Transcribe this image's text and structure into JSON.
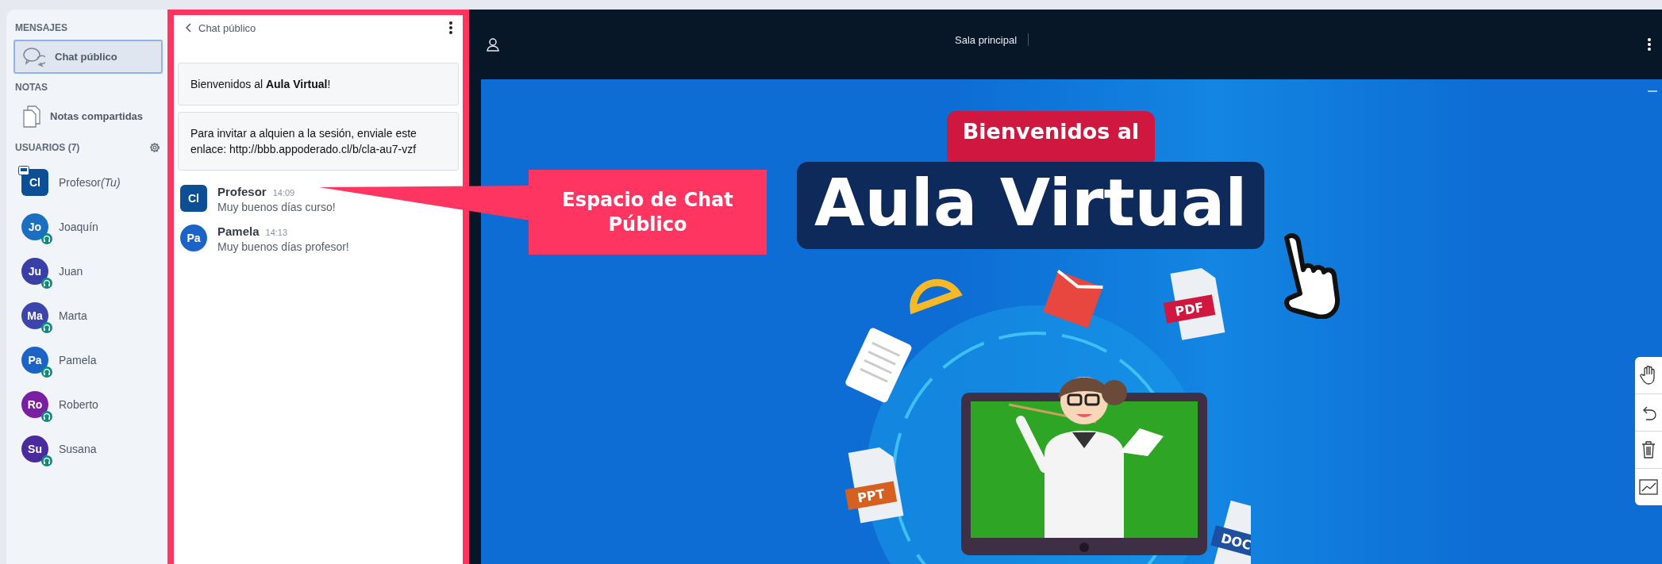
{
  "sidebar": {
    "sections": [
      {
        "heading": "MENSAJES",
        "items": [
          {
            "label": "Chat público",
            "kind": "chat",
            "selected": true
          }
        ]
      },
      {
        "heading": "NOTAS",
        "items": [
          {
            "label": "Notas compartidas",
            "kind": "notes",
            "selected": false
          }
        ]
      }
    ],
    "users_heading": "USUARIOS (7)",
    "users": [
      {
        "initials": "Cl",
        "name": "Profesor",
        "suffix": "(Tu)",
        "kind": "moderator",
        "color": "#0d4f94"
      },
      {
        "initials": "Jo",
        "name": "Joaquín",
        "kind": "viewer",
        "color": "#1b6fc0"
      },
      {
        "initials": "Ju",
        "name": "Juan",
        "kind": "viewer",
        "color": "#3a3fa8"
      },
      {
        "initials": "Ma",
        "name": "Marta",
        "kind": "viewer",
        "color": "#3b45ab"
      },
      {
        "initials": "Pa",
        "name": "Pamela",
        "kind": "viewer",
        "color": "#1c63c7"
      },
      {
        "initials": "Ro",
        "name": "Roberto",
        "kind": "viewer",
        "color": "#7b1fa2"
      },
      {
        "initials": "Su",
        "name": "Susana",
        "kind": "viewer",
        "color": "#4a2a9f"
      }
    ]
  },
  "chat": {
    "title": "Chat público",
    "notices": [
      "Bienvenidos al **Aula Virtual**!",
      "Para invitar a alquien a la sesión, enviale este enlace: http://bbb.appoderado.cl/b/cla-au7-vzf"
    ],
    "messages": [
      {
        "initials": "Cl",
        "sender": "Profesor",
        "time": "14:09",
        "text": "Muy buenos días curso!",
        "kind": "moderator",
        "color": "#0d4f94"
      },
      {
        "initials": "Pa",
        "sender": "Pamela",
        "time": "14:13",
        "text": "Muy buenos días profesor!",
        "kind": "viewer",
        "color": "#1c63c7"
      }
    ]
  },
  "main": {
    "room_title": "Sala principal",
    "slide": {
      "banner": "Bienvenidos al",
      "title": "Aula Virtual",
      "doc_labels": [
        "PDF",
        "PPT",
        "DOC"
      ]
    }
  },
  "callout": {
    "text": "Espacio de Chat Público"
  }
}
